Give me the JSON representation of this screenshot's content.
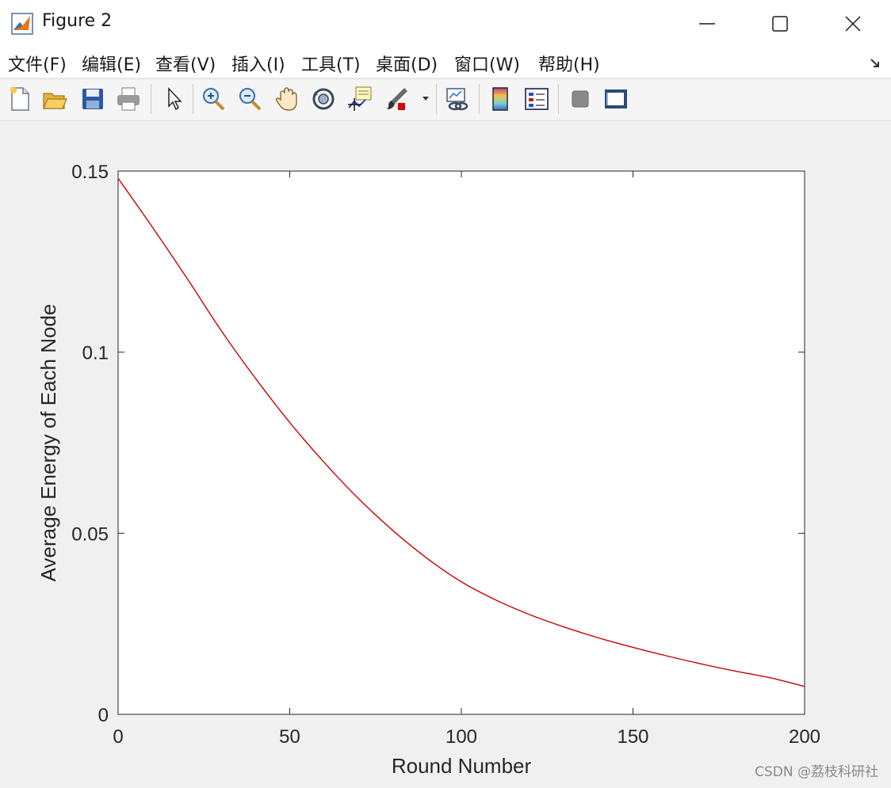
{
  "window": {
    "title": "Figure 2"
  },
  "menu": {
    "items": [
      "文件(F)",
      "编辑(E)",
      "查看(V)",
      "插入(I)",
      "工具(T)",
      "桌面(D)",
      "窗口(W)",
      "帮助(H)"
    ]
  },
  "toolbar": {
    "icons": [
      "new-file-icon",
      "open-folder-icon",
      "save-icon",
      "print-icon",
      "edit-plot-icon",
      "zoom-in-icon",
      "zoom-out-icon",
      "pan-icon",
      "rotate-3d-icon",
      "data-cursor-icon",
      "brush-icon",
      "link-plot-icon",
      "colorbar-icon",
      "legend-icon",
      "hide-plot-tools-icon",
      "show-plot-tools-icon"
    ]
  },
  "chart_data": {
    "type": "line",
    "title": "",
    "xlabel": "Round Number",
    "ylabel": "Average Energy of Each Node",
    "xlim": [
      0,
      200
    ],
    "ylim": [
      0,
      0.15
    ],
    "xticks": [
      "0",
      "50",
      "100",
      "150",
      "200"
    ],
    "yticks": [
      "0",
      "0.05",
      "0.1",
      "0.15"
    ],
    "line_color": "#cc0000",
    "grid": false,
    "series": [
      {
        "x": [
          0,
          10,
          20,
          30,
          40,
          50,
          60,
          70,
          80,
          90,
          100,
          110,
          120,
          130,
          140,
          150,
          160,
          170,
          180,
          190,
          200
        ],
        "y": [
          0.148,
          0.1345,
          0.1205,
          0.106,
          0.0928,
          0.0806,
          0.0696,
          0.0596,
          0.0508,
          0.0431,
          0.0366,
          0.0316,
          0.0275,
          0.0241,
          0.0211,
          0.0185,
          0.0161,
          0.0139,
          0.0119,
          0.0101,
          0.0077
        ]
      }
    ]
  },
  "watermark": "CSDN @荔枝科研社"
}
